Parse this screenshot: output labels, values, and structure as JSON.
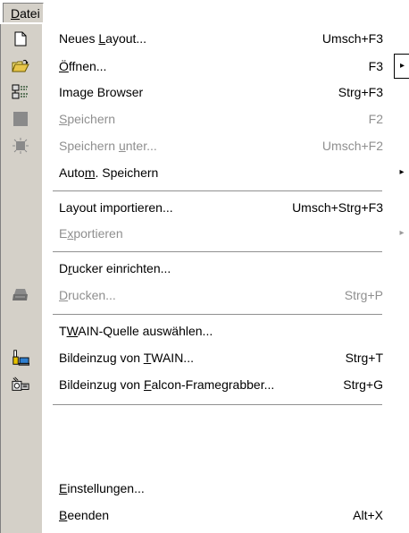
{
  "menubar": {
    "file_menu": {
      "before": "",
      "mnemonic": "D",
      "after": "atei"
    }
  },
  "menu": {
    "items": [
      {
        "id": "neues-layout",
        "before": "Neues ",
        "mnemonic": "L",
        "after": "ayout...",
        "shortcut": "Umsch+F3",
        "icon": "new-document-icon",
        "enabled": true
      },
      {
        "id": "oeffnen",
        "before": "",
        "mnemonic": "Ö",
        "after": "ffnen...",
        "shortcut": "F3",
        "icon": "open-folder-icon",
        "enabled": true,
        "submenu_arrow": "▸"
      },
      {
        "id": "image-browser",
        "before": "Image Browser",
        "mnemonic": "",
        "after": "",
        "shortcut": "Strg+F3",
        "icon": "image-browser-icon",
        "enabled": true
      },
      {
        "id": "speichern",
        "before": "",
        "mnemonic": "S",
        "after": "peichern",
        "shortcut": "F2",
        "icon": "save-icon",
        "enabled": false
      },
      {
        "id": "speichern-unter",
        "before": "Speichern ",
        "mnemonic": "u",
        "after": "nter...",
        "shortcut": "Umsch+F2",
        "icon": "save-as-icon",
        "enabled": false
      },
      {
        "id": "auto-speichern",
        "before": "Auto",
        "mnemonic": "m",
        "after": ". Speichern",
        "shortcut": "",
        "enabled": true,
        "submenu_arrow": "▸"
      },
      {
        "id": "layout-importieren",
        "before": "Layout importieren...",
        "mnemonic": "",
        "after": "",
        "shortcut": "Umsch+Strg+F3",
        "enabled": true
      },
      {
        "id": "exportieren",
        "before": "E",
        "mnemonic": "x",
        "after": "portieren",
        "shortcut": "",
        "enabled": false,
        "submenu_arrow": "▸"
      },
      {
        "id": "drucker-einrichten",
        "before": "D",
        "mnemonic": "r",
        "after": "ucker einrichten...",
        "shortcut": "",
        "enabled": true
      },
      {
        "id": "drucken",
        "before": "",
        "mnemonic": "D",
        "after": "rucken...",
        "shortcut": "Strg+P",
        "icon": "printer-icon",
        "enabled": false
      },
      {
        "id": "twain-quelle",
        "before": "T",
        "mnemonic": "W",
        "after": "AIN-Quelle auswählen...",
        "shortcut": "",
        "enabled": true
      },
      {
        "id": "bildeinzug-twain",
        "before": "Bildeinzug von ",
        "mnemonic": "T",
        "after": "WAIN...",
        "shortcut": "Strg+T",
        "icon": "scanner-camera-icon",
        "enabled": true
      },
      {
        "id": "bildeinzug-falcon",
        "before": "Bildeinzug von ",
        "mnemonic": "F",
        "after": "alcon-Framegrabber...",
        "shortcut": "Strg+G",
        "icon": "framegrabber-icon",
        "enabled": true
      },
      {
        "id": "einstellungen",
        "before": "",
        "mnemonic": "E",
        "after": "instellungen...",
        "shortcut": "",
        "enabled": true
      },
      {
        "id": "beenden",
        "before": "",
        "mnemonic": "B",
        "after": "eenden",
        "shortcut": "Alt+X",
        "enabled": true
      }
    ]
  }
}
